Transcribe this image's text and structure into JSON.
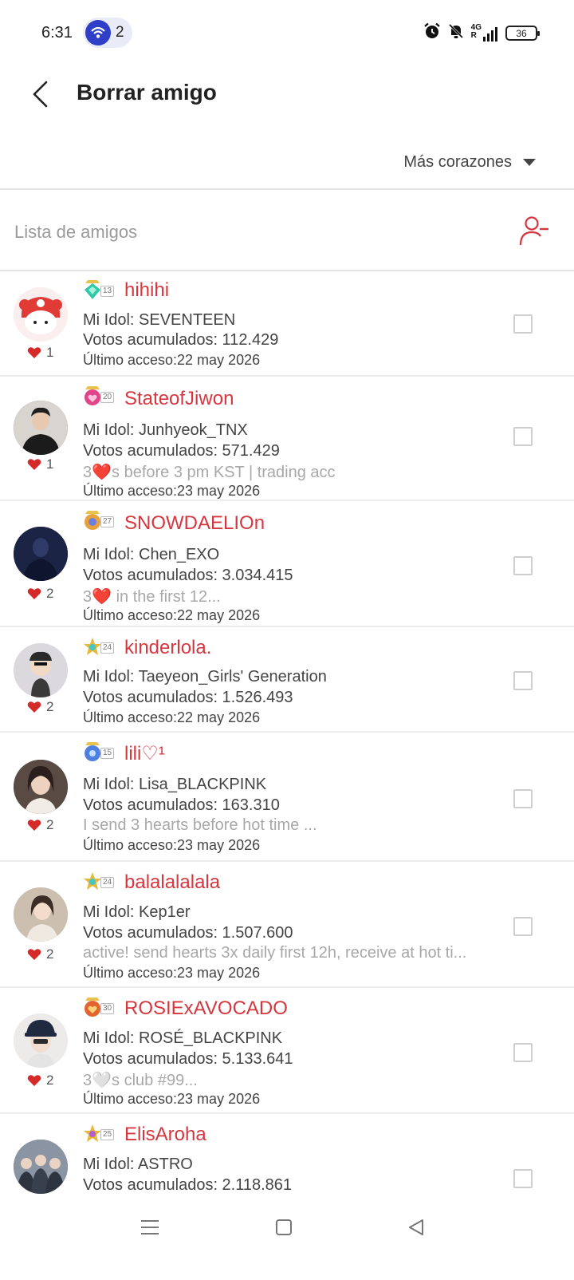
{
  "status_bar": {
    "time": "6:31",
    "hotspot_count": "2",
    "network": "4G",
    "roaming": "R",
    "battery": "36"
  },
  "header": {
    "title": "Borrar amigo"
  },
  "sort": {
    "selected": "Más corazones"
  },
  "list": {
    "title": "Lista de amigos"
  },
  "friends": [
    {
      "name": "hihihi",
      "level": "13",
      "hearts": "1",
      "idol": "Mi Idol: SEVENTEEN",
      "votes": "Votos acumulados: 112.429",
      "status": "",
      "last_access": "Último acceso:22 may 2026",
      "badge_color": "#2fc9a8",
      "avatar_bg": "#f7e4e4"
    },
    {
      "name": "StateofJiwon",
      "level": "20",
      "hearts": "1",
      "idol": "Mi Idol: Junhyeok_TNX",
      "votes": "Votos acumulados: 571.429",
      "status": "3❤️s before 3 pm KST | trading acc",
      "last_access": "Último acceso:23 may 2026",
      "badge_color": "#e0458a",
      "avatar_bg": "#3b3b3b"
    },
    {
      "name": "SNOWDAELIOn",
      "level": "27",
      "hearts": "2",
      "idol": "Mi Idol: Chen_EXO",
      "votes": "Votos acumulados: 3.034.415",
      "status": "3❤️ in the first 12...",
      "last_access": "Último acceso:22 may 2026",
      "badge_color": "#e8a23a",
      "avatar_bg": "#1c2446"
    },
    {
      "name": "kinderlola.",
      "level": "24",
      "hearts": "2",
      "idol": "Mi Idol: Taeyeon_Girls' Generation",
      "votes": "Votos acumulados: 1.526.493",
      "status": "",
      "last_access": "Último acceso:22 may 2026",
      "badge_color": "#e8b83a",
      "avatar_bg": "#d9d7dc"
    },
    {
      "name": "lili♡¹",
      "level": "15",
      "hearts": "2",
      "idol": "Mi Idol: Lisa_BLACKPINK",
      "votes": "Votos acumulados: 163.310",
      "status": "I send 3 hearts before hot time ...",
      "last_access": "Último acceso:23 may 2026",
      "badge_color": "#4f7fe0",
      "avatar_bg": "#5a4a44"
    },
    {
      "name": "balalalalala",
      "level": "24",
      "hearts": "2",
      "idol": "Mi Idol: Kep1er",
      "votes": "Votos acumulados: 1.507.600",
      "status": "active! send hearts 3x daily first 12h, receive at hot ti...",
      "last_access": "Último acceso:23 may 2026",
      "badge_color": "#e8b83a",
      "avatar_bg": "#cdbfb0"
    },
    {
      "name": "ROSIExAVOCADO",
      "level": "30",
      "hearts": "2",
      "idol": "Mi Idol: ROSÉ_BLACKPINK",
      "votes": "Votos acumulados: 5.133.641",
      "status": "3🤍s club #99...",
      "last_access": "Último acceso:23 may 2026",
      "badge_color": "#e2642e",
      "avatar_bg": "#e9e6e3"
    },
    {
      "name": "ElisAroha",
      "level": "25",
      "hearts": "",
      "idol": "Mi Idol: ASTRO",
      "votes": "Votos acumulados: 2.118.861",
      "status": "",
      "last_access": "",
      "badge_color": "#e8b83a",
      "avatar_bg": "#4a5566"
    }
  ]
}
